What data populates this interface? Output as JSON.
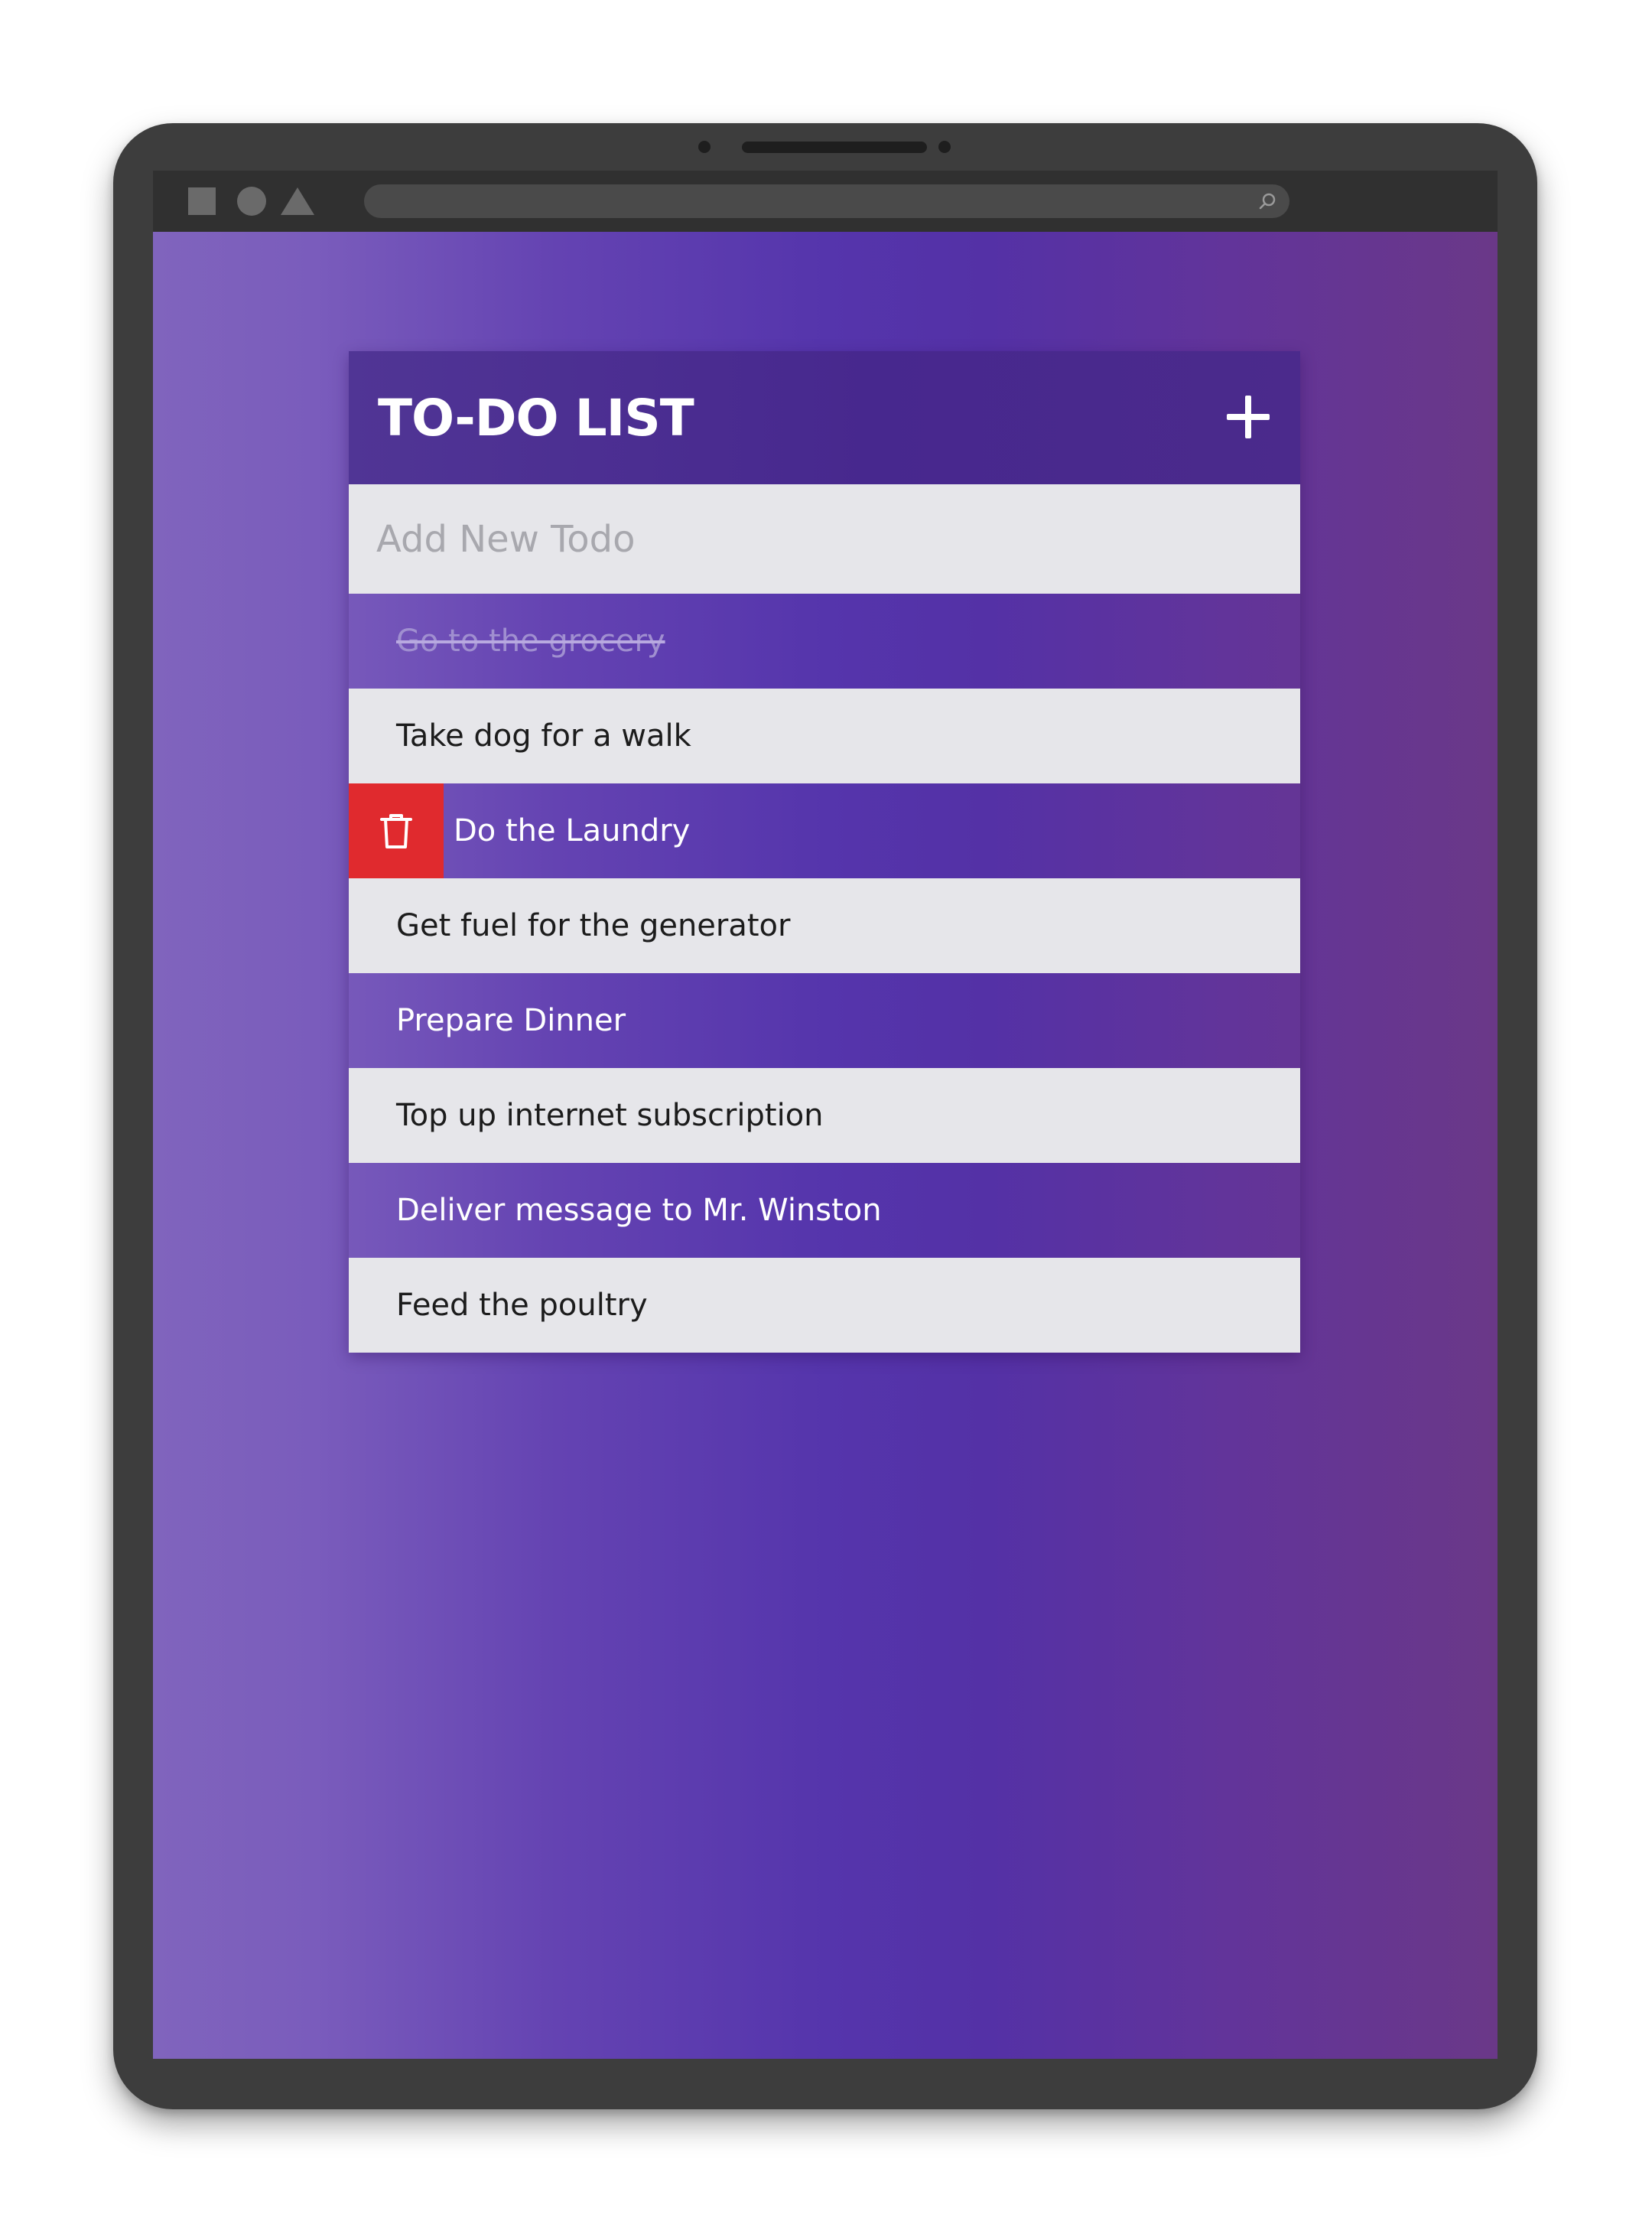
{
  "app": {
    "title": "TO-DO LIST",
    "add_button_symbol": "+",
    "new_todo_placeholder": "Add New Todo"
  },
  "colors": {
    "accent_purple": "#5535ac",
    "header_purple": "#47288e",
    "item_light": "#e6e6ea",
    "delete_red": "#e02a2e",
    "device_frame": "#3d3d3d"
  },
  "todos": [
    {
      "text": "Go to the grocery",
      "completed": true
    },
    {
      "text": "Take dog for a walk",
      "completed": false
    },
    {
      "text": "Do the Laundry",
      "completed": false,
      "delete_visible": true,
      "delete_icon": "trash-icon"
    },
    {
      "text": "Get fuel for the generator",
      "completed": false
    },
    {
      "text": "Prepare Dinner",
      "completed": false
    },
    {
      "text": "Top up internet subscription",
      "completed": false
    },
    {
      "text": "Deliver message to Mr. Winston",
      "completed": false
    },
    {
      "text": "Feed the poultry",
      "completed": false
    }
  ],
  "browser_toolbar": {
    "icons": [
      "square-icon",
      "circle-icon",
      "triangle-icon",
      "search-icon"
    ]
  }
}
